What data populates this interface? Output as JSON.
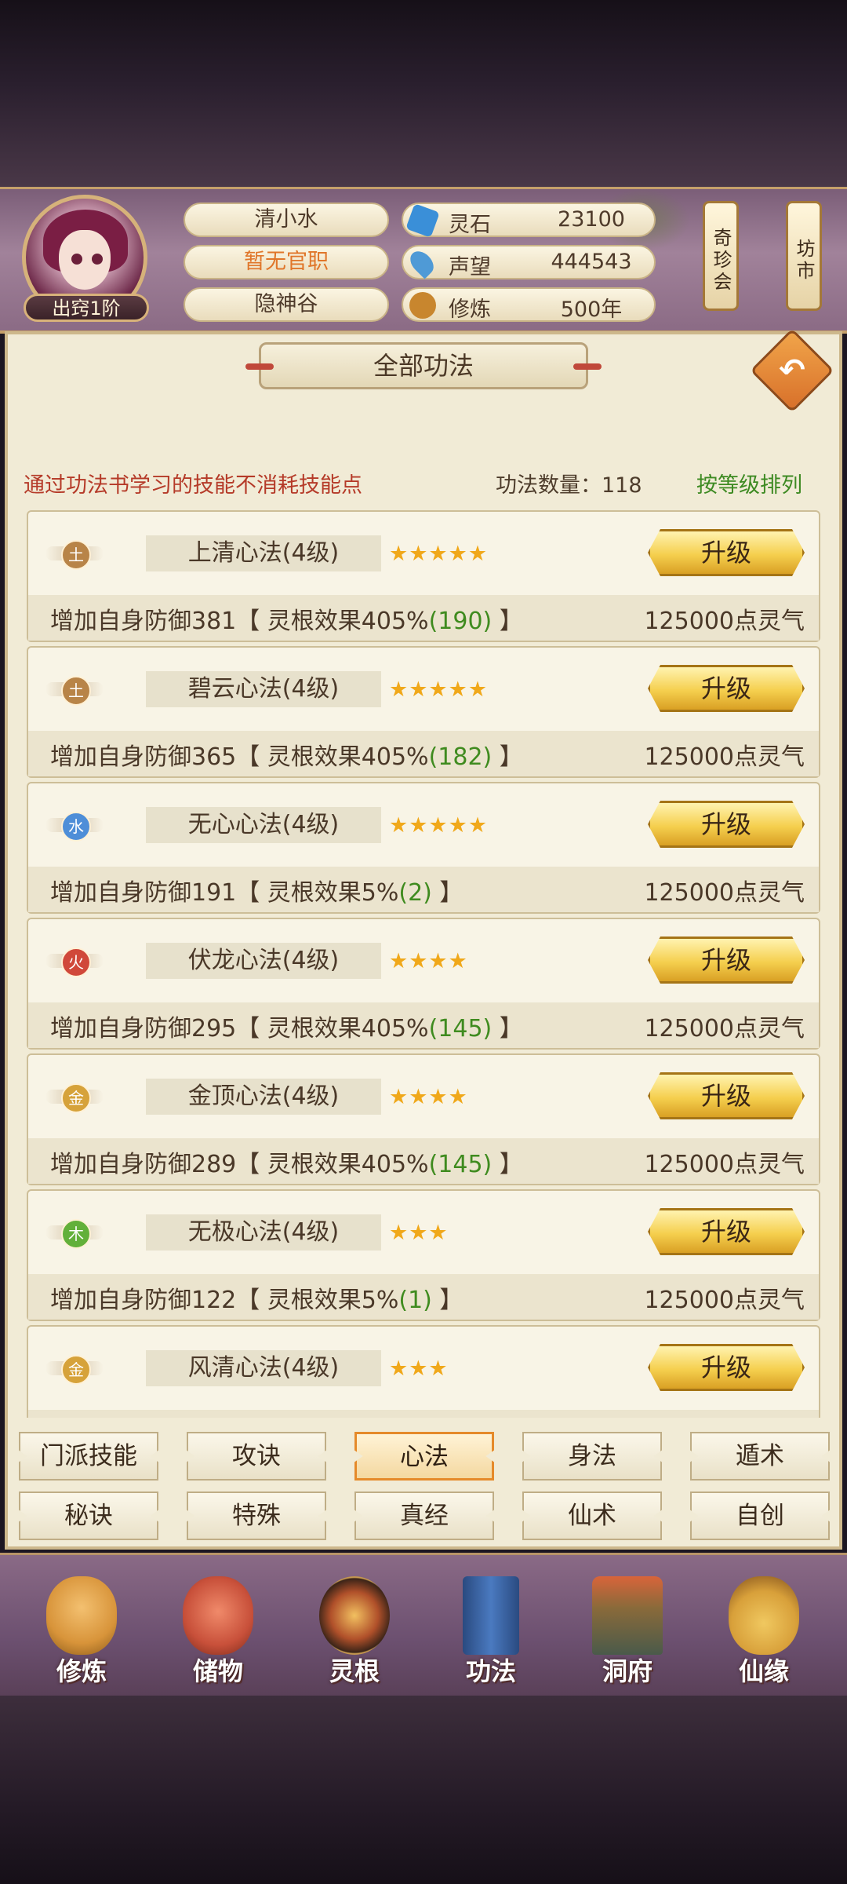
{
  "player": {
    "name": "清小水",
    "title": "暂无官职",
    "sect": "隐神谷",
    "rank": "出窍1阶"
  },
  "resources": [
    {
      "label": "灵石",
      "value": "23100",
      "icon": "spirit-stone-icon",
      "color": "#3a8fd8"
    },
    {
      "label": "声望",
      "value": "444543",
      "icon": "reputation-icon",
      "color": "#4f9ad6"
    },
    {
      "label": "修炼",
      "value": "500年",
      "icon": "meditation-icon",
      "color": "#c8862e"
    }
  ],
  "side_buttons": [
    "奇珍会",
    "坊市"
  ],
  "panel": {
    "title": "全部功法",
    "notice": "通过功法书学习的技能不消耗技能点",
    "count": "功法数量：118",
    "sort_label": "按等级排列"
  },
  "skills": [
    {
      "element": "土",
      "elem_color": "#b88448",
      "name": "上清心法(4级)",
      "stars": "★★★★★",
      "desc_prefix": "增加自身防御381【 灵根效果405%",
      "desc_value": "(190)",
      "desc_suffix": " 】",
      "cost": "125000点灵气",
      "button": "升级"
    },
    {
      "element": "土",
      "elem_color": "#b88448",
      "name": "碧云心法(4级)",
      "stars": "★★★★★",
      "desc_prefix": "增加自身防御365【 灵根效果405%",
      "desc_value": "(182)",
      "desc_suffix": " 】",
      "cost": "125000点灵气",
      "button": "升级"
    },
    {
      "element": "水",
      "elem_color": "#4e8ed8",
      "name": "无心心法(4级)",
      "stars": "★★★★★",
      "desc_prefix": "增加自身防御191【 灵根效果5%",
      "desc_value": "(2)",
      "desc_suffix": " 】",
      "cost": "125000点灵气",
      "button": "升级"
    },
    {
      "element": "火",
      "elem_color": "#d0483a",
      "name": "伏龙心法(4级)",
      "stars": "★★★★",
      "desc_prefix": "增加自身防御295【 灵根效果405%",
      "desc_value": "(145)",
      "desc_suffix": " 】",
      "cost": "125000点灵气",
      "button": "升级"
    },
    {
      "element": "金",
      "elem_color": "#d6a23a",
      "name": "金顶心法(4级)",
      "stars": "★★★★",
      "desc_prefix": "增加自身防御289【 灵根效果405%",
      "desc_value": "(145)",
      "desc_suffix": " 】",
      "cost": "125000点灵气",
      "button": "升级"
    },
    {
      "element": "木",
      "elem_color": "#62b03a",
      "name": "无极心法(4级)",
      "stars": "★★★",
      "desc_prefix": "增加自身防御122【 灵根效果5%",
      "desc_value": "(1)",
      "desc_suffix": " 】",
      "cost": "125000点灵气",
      "button": "升级"
    },
    {
      "element": "金",
      "elem_color": "#d6a23a",
      "name": "风清心法(4级)",
      "stars": "★★★",
      "desc_prefix": "",
      "desc_value": "",
      "desc_suffix": "",
      "cost": "",
      "button": "升级"
    }
  ],
  "tabs": [
    {
      "label": "门派技能",
      "active": false
    },
    {
      "label": "攻诀",
      "active": false
    },
    {
      "label": "心法",
      "active": true
    },
    {
      "label": "身法",
      "active": false
    },
    {
      "label": "遁术",
      "active": false
    },
    {
      "label": "秘诀",
      "active": false
    },
    {
      "label": "特殊",
      "active": false
    },
    {
      "label": "真经",
      "active": false
    },
    {
      "label": "仙术",
      "active": false
    },
    {
      "label": "自创",
      "active": false
    }
  ],
  "nav": [
    {
      "label": "修炼",
      "icon": "cultivate-icon",
      "color": "#d8943a"
    },
    {
      "label": "储物",
      "icon": "storage-bag-icon",
      "color": "#c8503a"
    },
    {
      "label": "灵根",
      "icon": "spirit-root-icon",
      "color": "#b0502a"
    },
    {
      "label": "功法",
      "icon": "skill-book-icon",
      "color": "#3a6aa8"
    },
    {
      "label": "洞府",
      "icon": "cave-house-icon",
      "color": "#8a6a3a"
    },
    {
      "label": "仙缘",
      "icon": "gourd-icon",
      "color": "#d8a03a"
    }
  ]
}
